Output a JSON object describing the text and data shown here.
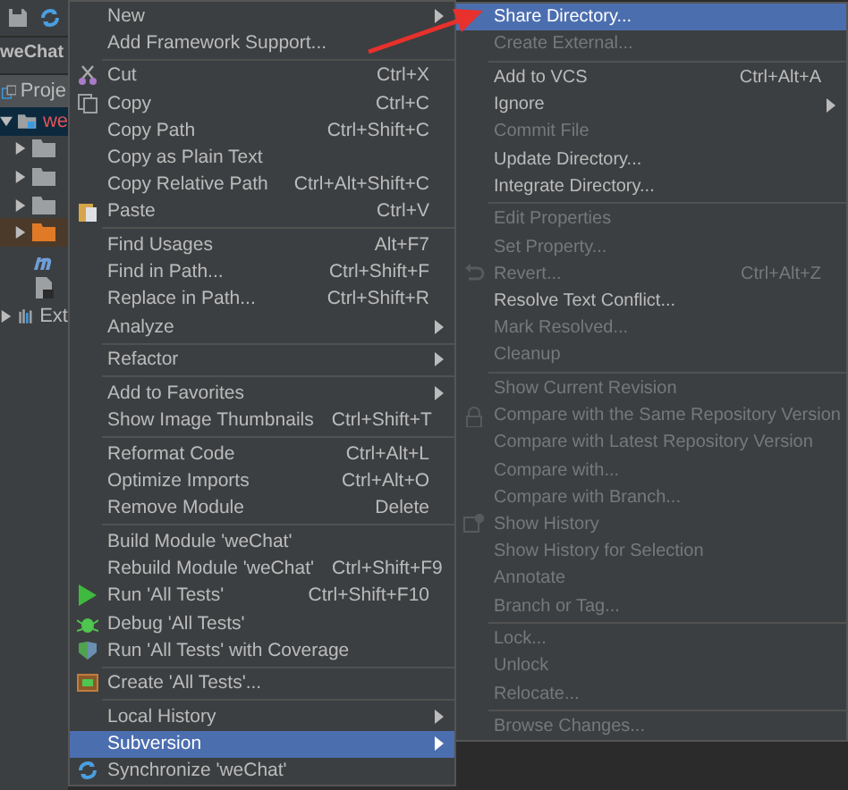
{
  "project_panel": {
    "breadcrumb": "weChat",
    "tab": "Proje",
    "tree": [
      {
        "kind": "module",
        "label": "we",
        "selected": true,
        "expanded": true,
        "children": [
          {
            "kind": "folder",
            "expanded": false
          },
          {
            "kind": "folder",
            "expanded": false
          },
          {
            "kind": "folder",
            "expanded": false
          },
          {
            "kind": "folder",
            "expanded": false,
            "highlighted": true
          },
          {
            "kind": "file"
          },
          {
            "kind": "file"
          }
        ]
      },
      {
        "kind": "library",
        "label": "Ext",
        "expanded": false
      }
    ]
  },
  "context_menu": {
    "items": [
      {
        "kind": "item",
        "label": "New",
        "submenu": true
      },
      {
        "kind": "item",
        "label": "Add Framework Support..."
      },
      {
        "kind": "separator"
      },
      {
        "kind": "item",
        "label": "Cut",
        "shortcut": "Ctrl+X"
      },
      {
        "kind": "item",
        "label": "Copy",
        "shortcut": "Ctrl+C"
      },
      {
        "kind": "item",
        "label": "Copy Path",
        "shortcut": "Ctrl+Shift+C"
      },
      {
        "kind": "item",
        "label": "Copy as Plain Text"
      },
      {
        "kind": "item",
        "label": "Copy Relative Path",
        "shortcut": "Ctrl+Alt+Shift+C"
      },
      {
        "kind": "item",
        "label": "Paste",
        "shortcut": "Ctrl+V"
      },
      {
        "kind": "separator"
      },
      {
        "kind": "item",
        "label": "Find Usages",
        "shortcut": "Alt+F7"
      },
      {
        "kind": "item",
        "label": "Find in Path...",
        "shortcut": "Ctrl+Shift+F"
      },
      {
        "kind": "item",
        "label": "Replace in Path...",
        "shortcut": "Ctrl+Shift+R"
      },
      {
        "kind": "item",
        "label": "Analyze",
        "submenu": true
      },
      {
        "kind": "separator"
      },
      {
        "kind": "item",
        "label": "Refactor",
        "submenu": true
      },
      {
        "kind": "separator"
      },
      {
        "kind": "item",
        "label": "Add to Favorites",
        "submenu": true
      },
      {
        "kind": "item",
        "label": "Show Image Thumbnails",
        "shortcut": "Ctrl+Shift+T"
      },
      {
        "kind": "separator"
      },
      {
        "kind": "item",
        "label": "Reformat Code",
        "shortcut": "Ctrl+Alt+L"
      },
      {
        "kind": "item",
        "label": "Optimize Imports",
        "shortcut": "Ctrl+Alt+O"
      },
      {
        "kind": "item",
        "label": "Remove Module",
        "shortcut": "Delete"
      },
      {
        "kind": "separator"
      },
      {
        "kind": "item",
        "label": "Build Module 'weChat'"
      },
      {
        "kind": "item",
        "label": "Rebuild Module 'weChat'",
        "shortcut": "Ctrl+Shift+F9"
      },
      {
        "kind": "item",
        "label": "Run 'All Tests'",
        "shortcut": "Ctrl+Shift+F10"
      },
      {
        "kind": "item",
        "label": "Debug 'All Tests'"
      },
      {
        "kind": "item",
        "label": "Run 'All Tests' with Coverage"
      },
      {
        "kind": "separator"
      },
      {
        "kind": "item",
        "label": "Create 'All Tests'..."
      },
      {
        "kind": "separator"
      },
      {
        "kind": "item",
        "label": "Local History",
        "submenu": true
      },
      {
        "kind": "item",
        "label": "Subversion",
        "submenu": true,
        "selected": true
      },
      {
        "kind": "item",
        "label": "Synchronize 'weChat'"
      }
    ]
  },
  "subversion_menu": {
    "items": [
      {
        "kind": "item",
        "label": "Share Directory...",
        "selected": true
      },
      {
        "kind": "item",
        "label": "Create External...",
        "disabled": true
      },
      {
        "kind": "separator"
      },
      {
        "kind": "item",
        "label": "Add to VCS",
        "shortcut": "Ctrl+Alt+A"
      },
      {
        "kind": "item",
        "label": "Ignore",
        "submenu": true
      },
      {
        "kind": "item",
        "label": "Commit File",
        "disabled": true
      },
      {
        "kind": "item",
        "label": "Update Directory..."
      },
      {
        "kind": "item",
        "label": "Integrate Directory..."
      },
      {
        "kind": "separator"
      },
      {
        "kind": "item",
        "label": "Edit Properties",
        "disabled": true
      },
      {
        "kind": "item",
        "label": "Set Property...",
        "disabled": true
      },
      {
        "kind": "item",
        "label": "Revert...",
        "shortcut": "Ctrl+Alt+Z",
        "disabled": true
      },
      {
        "kind": "item",
        "label": "Resolve Text Conflict..."
      },
      {
        "kind": "item",
        "label": "Mark Resolved...",
        "disabled": true
      },
      {
        "kind": "item",
        "label": "Cleanup",
        "disabled": true
      },
      {
        "kind": "separator"
      },
      {
        "kind": "item",
        "label": "Show Current Revision",
        "disabled": true
      },
      {
        "kind": "item",
        "label": "Compare with the Same Repository Version",
        "disabled": true
      },
      {
        "kind": "item",
        "label": "Compare with Latest Repository Version",
        "disabled": true
      },
      {
        "kind": "item",
        "label": "Compare with...",
        "disabled": true
      },
      {
        "kind": "item",
        "label": "Compare with Branch...",
        "disabled": true
      },
      {
        "kind": "item",
        "label": "Show History",
        "disabled": true
      },
      {
        "kind": "item",
        "label": "Show History for Selection",
        "disabled": true
      },
      {
        "kind": "item",
        "label": "Annotate",
        "disabled": true
      },
      {
        "kind": "item",
        "label": "Branch or Tag...",
        "disabled": true
      },
      {
        "kind": "separator"
      },
      {
        "kind": "item",
        "label": "Lock...",
        "disabled": true
      },
      {
        "kind": "item",
        "label": "Unlock",
        "disabled": true
      },
      {
        "kind": "item",
        "label": "Relocate...",
        "disabled": true
      },
      {
        "kind": "separator"
      },
      {
        "kind": "item",
        "label": "Browse Changes...",
        "disabled": true
      }
    ]
  },
  "annotation": {
    "kind": "arrow"
  }
}
